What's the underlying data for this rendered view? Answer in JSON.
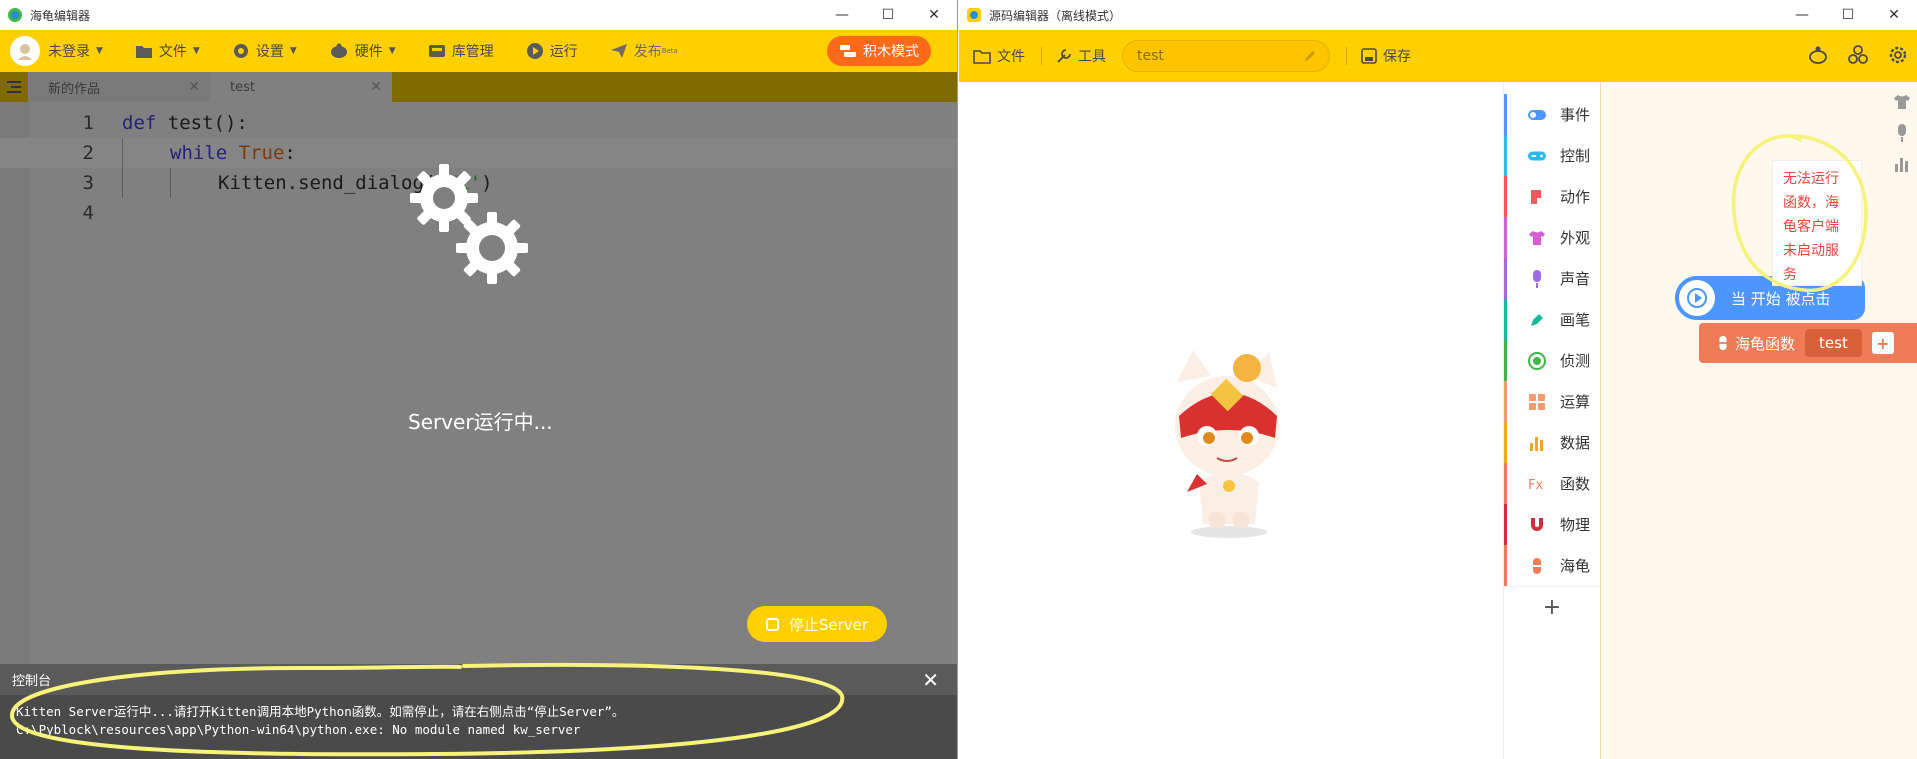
{
  "left_window": {
    "title": "海龟编辑器",
    "toolbar": {
      "user": "未登录",
      "file": "文件",
      "settings": "设置",
      "hardware": "硬件",
      "library": "库管理",
      "run": "运行",
      "publish": "发布",
      "publish_badge": "Beta",
      "block_mode": "积木模式"
    },
    "tabs": [
      {
        "label": "新的作品"
      },
      {
        "label": "test"
      }
    ],
    "code": {
      "line_numbers": [
        "1",
        "2",
        "3",
        "4"
      ],
      "line1_kw": "def",
      "line1_rest": " test():",
      "line2_kw": "while",
      "line2_kw2": "True",
      "line2_rest": ":",
      "line3_pre": "Kitten.send_dialog(",
      "line3_str": "'Hi'",
      "line3_post": ")"
    },
    "server_status": "Server运行中...",
    "stop_server": "停止Server",
    "console": {
      "title": "控制台",
      "lines": [
        "Kitten Server运行中...请打开Kitten调用本地Python函数。如需停止，请在右侧点击“停止Server”。",
        "C:\\Pyblock\\resources\\app\\Python-win64\\python.exe: No module named kw_server"
      ]
    }
  },
  "right_window": {
    "title": "源码编辑器（离线模式）",
    "toolbar": {
      "file": "文件",
      "tools": "工具",
      "project_name": "test",
      "save": "保存"
    },
    "categories": [
      {
        "label": "事件",
        "color": "#4c97ff",
        "icon": "toggle-icon"
      },
      {
        "label": "控制",
        "color": "#2fb7f0",
        "icon": "gamepad-icon"
      },
      {
        "label": "动作",
        "color": "#f05a5a",
        "icon": "figure-icon"
      },
      {
        "label": "外观",
        "color": "#d95dd5",
        "icon": "shirt-icon"
      },
      {
        "label": "声音",
        "color": "#a06be0",
        "icon": "microphone-icon"
      },
      {
        "label": "画笔",
        "color": "#18b89a",
        "icon": "pen-icon"
      },
      {
        "label": "侦测",
        "color": "#3fb84a",
        "icon": "radar-icon"
      },
      {
        "label": "运算",
        "color": "#f59a6b",
        "icon": "calculator-icon"
      },
      {
        "label": "数据",
        "color": "#f5a623",
        "icon": "chart-icon"
      },
      {
        "label": "函数",
        "color": "#f07c57",
        "icon": "function-icon"
      },
      {
        "label": "物理",
        "color": "#c8323c",
        "icon": "magnet-icon"
      },
      {
        "label": "海龟",
        "color": "#f07c57",
        "icon": "python-icon"
      }
    ],
    "add_category": "+",
    "tooltip": "无法运行函数，海龟客户端未启动服务",
    "event_block": "当 开始 被点击",
    "func_block": {
      "label": "海龟函数",
      "arg": "test",
      "plus": "+"
    }
  },
  "window_controls": {
    "minimize": "—",
    "maximize": "☐",
    "close": "✕"
  }
}
